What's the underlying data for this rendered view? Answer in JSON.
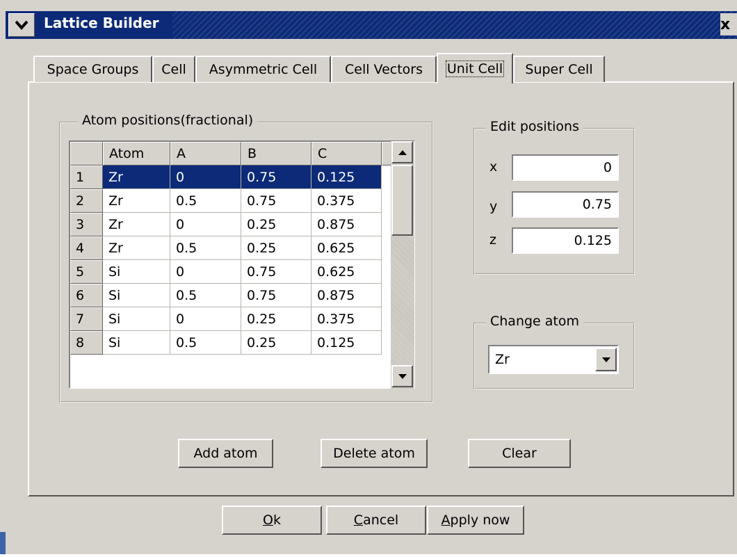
{
  "window": {
    "title": "Lattice Builder",
    "close_glyph": "x"
  },
  "tabs": [
    {
      "label": "Space Groups",
      "active": false
    },
    {
      "label": "Cell",
      "active": false
    },
    {
      "label": "Asymmetric Cell",
      "active": false
    },
    {
      "label": "Cell Vectors",
      "active": false
    },
    {
      "label": "Unit Cell",
      "active": true
    },
    {
      "label": "Super Cell",
      "active": false
    }
  ],
  "atom_positions": {
    "title": "Atom positions(fractional)",
    "columns": [
      "Atom",
      "A",
      "B",
      "C"
    ],
    "rows": [
      {
        "num": "1",
        "atom": "Zr",
        "a": "0",
        "b": "0.75",
        "c": "0.125",
        "selected": true
      },
      {
        "num": "2",
        "atom": "Zr",
        "a": "0.5",
        "b": "0.75",
        "c": "0.375",
        "selected": false
      },
      {
        "num": "3",
        "atom": "Zr",
        "a": "0",
        "b": "0.25",
        "c": "0.875",
        "selected": false
      },
      {
        "num": "4",
        "atom": "Zr",
        "a": "0.5",
        "b": "0.25",
        "c": "0.625",
        "selected": false
      },
      {
        "num": "5",
        "atom": "Si",
        "a": "0",
        "b": "0.75",
        "c": "0.625",
        "selected": false
      },
      {
        "num": "6",
        "atom": "Si",
        "a": "0.5",
        "b": "0.75",
        "c": "0.875",
        "selected": false
      },
      {
        "num": "7",
        "atom": "Si",
        "a": "0",
        "b": "0.25",
        "c": "0.375",
        "selected": false
      },
      {
        "num": "8",
        "atom": "Si",
        "a": "0.5",
        "b": "0.25",
        "c": "0.125",
        "selected": false
      }
    ]
  },
  "edit_positions": {
    "title": "Edit positions",
    "x_label": "x",
    "x_value": "0",
    "y_label": "y",
    "y_value": "0.75",
    "z_label": "z",
    "z_value": "0.125"
  },
  "change_atom": {
    "title": "Change atom",
    "selected": "Zr"
  },
  "actions": {
    "add_atom": "Add atom",
    "delete_atom": "Delete atom",
    "clear": "Clear"
  },
  "dialog_buttons": {
    "ok_mnemonic": "O",
    "ok_rest": "k",
    "cancel_mnemonic": "C",
    "cancel_rest": "ancel",
    "apply_mnemonic": "A",
    "apply_rest": "pply now"
  },
  "colors": {
    "selection": "#0c2a78",
    "window_bg": "#d6d2cc",
    "titlebar": "#0c2a78"
  },
  "icons": {
    "menu": "chevron-down-icon",
    "close": "close-icon",
    "scroll_up": "arrow-up-icon",
    "scroll_down": "arrow-down-icon",
    "combo": "dropdown-arrow-icon"
  }
}
